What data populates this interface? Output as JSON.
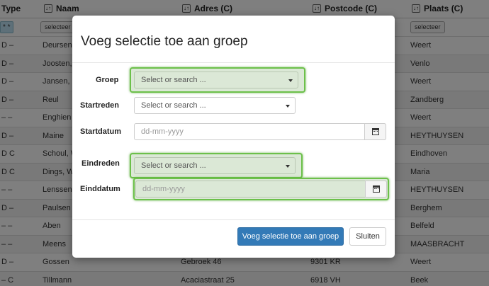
{
  "table": {
    "headers": [
      {
        "label": "Type",
        "sortable": false
      },
      {
        "label": "Naam",
        "sortable": true
      },
      {
        "label": "Adres (C)",
        "sortable": true
      },
      {
        "label": "Postcode (C)",
        "sortable": true
      },
      {
        "label": "Plaats (C)",
        "sortable": true
      }
    ],
    "filter_type_tag": "* *",
    "filter_label": "selecteer",
    "rows": [
      {
        "type": "D –",
        "naam": "Deursen,",
        "adres": "",
        "postcode": "",
        "plaats": "Weert"
      },
      {
        "type": "D –",
        "naam": "Joosten,",
        "adres": "",
        "postcode": "",
        "plaats": "Venlo"
      },
      {
        "type": "D –",
        "naam": "Jansen, M",
        "adres": "",
        "postcode": "",
        "plaats": "Weert"
      },
      {
        "type": "D –",
        "naam": "Reul",
        "adres": "",
        "postcode": "",
        "plaats": "Zandberg"
      },
      {
        "type": "– –",
        "naam": "Enghien",
        "adres": "",
        "postcode": "",
        "plaats": "Weert"
      },
      {
        "type": "D –",
        "naam": "Maine",
        "adres": "",
        "postcode": "",
        "plaats": "HEYTHUYSEN"
      },
      {
        "type": "D C",
        "naam": "Schoul, W",
        "adres": "",
        "postcode": "",
        "plaats": "Eindhoven"
      },
      {
        "type": "D C",
        "naam": "Dings, W",
        "adres": "",
        "postcode": "",
        "plaats": "Maria"
      },
      {
        "type": "– –",
        "naam": "Lenssen",
        "adres": "",
        "postcode": "",
        "plaats": "HEYTHUYSEN"
      },
      {
        "type": "D –",
        "naam": "Paulsen",
        "adres": "",
        "postcode": "",
        "plaats": "Berghem"
      },
      {
        "type": "– –",
        "naam": "Aben",
        "adres": "",
        "postcode": "",
        "plaats": "Belfeld"
      },
      {
        "type": "– –",
        "naam": "Meens",
        "adres": "",
        "postcode": "",
        "plaats": "MAASBRACHT"
      },
      {
        "type": "D –",
        "naam": "Gossen",
        "adres": "Gebroek 46",
        "postcode": "9301 KR",
        "plaats": "Weert"
      },
      {
        "type": "– C",
        "naam": "Tillmann",
        "adres": "Acaciastraat 25",
        "postcode": "6918 VH",
        "plaats": "Beek"
      }
    ]
  },
  "modal": {
    "title": "Voeg selectie toe aan groep",
    "fields": {
      "groep": {
        "label": "Groep",
        "placeholder": "Select or search ..."
      },
      "startreden": {
        "label": "Startreden",
        "placeholder": "Select or search ..."
      },
      "startdatum": {
        "label": "Startdatum",
        "placeholder": "dd-mm-yyyy"
      },
      "eindreden": {
        "label": "Eindreden",
        "placeholder": "Select or search ..."
      },
      "einddatum": {
        "label": "Einddatum",
        "placeholder": "dd-mm-yyyy"
      }
    },
    "primary_button": "Voeg selectie toe aan groep",
    "close_button": "Sluiten"
  },
  "colors": {
    "primary": "#337ab7",
    "highlight_border": "#6cc04a",
    "highlight_fill": "#dbe8d6",
    "overlay": "rgba(0,0,0,0.5)"
  }
}
